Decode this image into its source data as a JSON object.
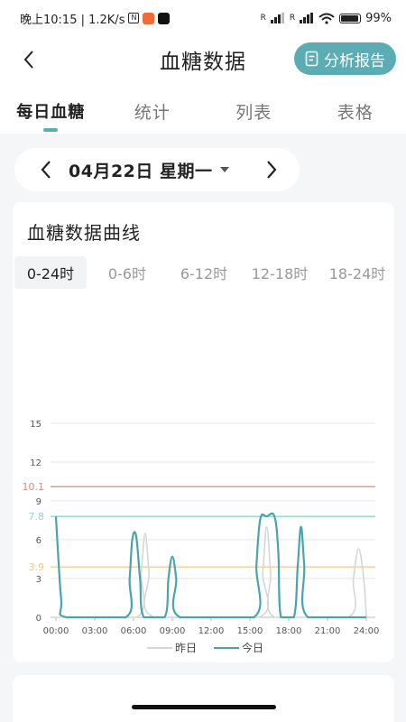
{
  "status_bar": {
    "time_speed": "晚上10:15 | 1.2K/s",
    "nfc": "N",
    "signal1": "R",
    "signal2": "R",
    "battery": "99%"
  },
  "header": {
    "title": "血糖数据",
    "report_button": "分析报告"
  },
  "tabs": [
    {
      "label": "每日血糖",
      "active": true
    },
    {
      "label": "统计",
      "active": false
    },
    {
      "label": "列表",
      "active": false
    },
    {
      "label": "表格",
      "active": false
    }
  ],
  "date_selector": {
    "date": "04月22日 星期一"
  },
  "chart_card": {
    "title": "血糖数据曲线",
    "ranges": [
      "0-24时",
      "0-6时",
      "6-12时",
      "12-18时",
      "18-24时"
    ],
    "active_range": "0-24时"
  },
  "colors": {
    "accent": "#5cacb3",
    "high_line": "#d98a7a",
    "target_line": "#8fd8c4",
    "low_line": "#f2c882",
    "yesterday": "#d6d6d6",
    "today": "#4aa3ad"
  },
  "chart_data": {
    "type": "line",
    "y_ticks": [
      0,
      3,
      6,
      9,
      12,
      15
    ],
    "ylim": [
      0,
      15
    ],
    "xlim": [
      0,
      24
    ],
    "x_ticks": [
      "00:00",
      "03:00",
      "06:00",
      "09:00",
      "12:00",
      "15:00",
      "18:00",
      "21:00",
      "24:00"
    ],
    "reference_lines": [
      {
        "label": "10.1",
        "value": 10.1,
        "color": "#d98a7a"
      },
      {
        "label": "7.8",
        "value": 7.8,
        "color": "#8fd8c4"
      },
      {
        "label": "3.9",
        "value": 3.9,
        "color": "#f2c882"
      }
    ],
    "series": [
      {
        "name": "昨日",
        "color": "#d6d6d6",
        "points": [
          [
            0,
            0
          ],
          [
            6.2,
            0
          ],
          [
            6.6,
            3.5
          ],
          [
            6.9,
            6.5
          ],
          [
            7.2,
            3.5
          ],
          [
            7.6,
            0
          ],
          [
            15.7,
            0
          ],
          [
            16.0,
            3.5
          ],
          [
            16.3,
            7.0
          ],
          [
            16.6,
            3.5
          ],
          [
            16.9,
            0
          ],
          [
            22.6,
            0
          ],
          [
            23.0,
            3.0
          ],
          [
            23.4,
            5.3
          ],
          [
            23.8,
            3.0
          ],
          [
            24,
            0
          ]
        ]
      },
      {
        "name": "今日",
        "color": "#4aa3ad",
        "points": [
          [
            0,
            7.8
          ],
          [
            0.4,
            1.5
          ],
          [
            0.8,
            0
          ],
          [
            5.4,
            0
          ],
          [
            5.7,
            3.0
          ],
          [
            5.9,
            6.0
          ],
          [
            6.2,
            6.3
          ],
          [
            6.5,
            3.0
          ],
          [
            6.8,
            0
          ],
          [
            8.4,
            0
          ],
          [
            8.7,
            3.0
          ],
          [
            9.0,
            4.7
          ],
          [
            9.3,
            3.0
          ],
          [
            9.6,
            0
          ],
          [
            15.3,
            0
          ],
          [
            15.5,
            4.0
          ],
          [
            15.8,
            7.6
          ],
          [
            16.3,
            7.8
          ],
          [
            16.9,
            7.8
          ],
          [
            17.2,
            5.0
          ],
          [
            17.4,
            0
          ],
          [
            18.4,
            0
          ],
          [
            18.7,
            4.0
          ],
          [
            18.95,
            7.0
          ],
          [
            19.2,
            4.0
          ],
          [
            19.5,
            0
          ],
          [
            24,
            0
          ]
        ]
      }
    ]
  }
}
